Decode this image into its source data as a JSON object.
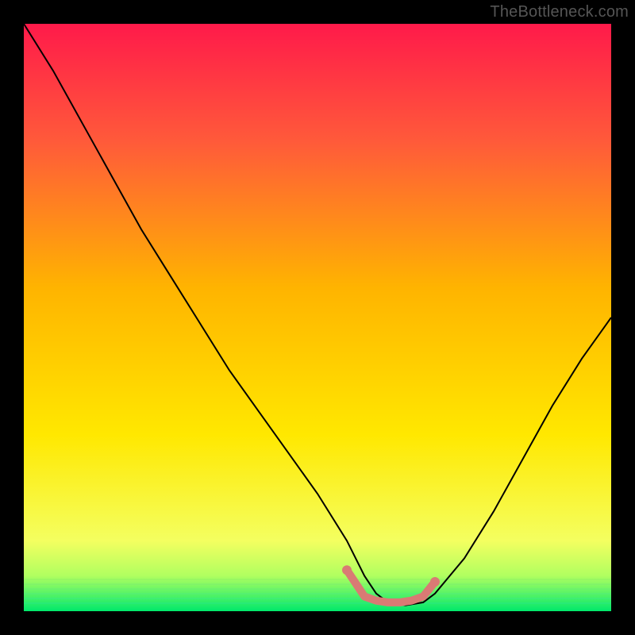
{
  "watermark": "TheBottleneck.com",
  "chart_data": {
    "type": "line",
    "title": "",
    "xlabel": "",
    "ylabel": "",
    "xlim": [
      0,
      100
    ],
    "ylim": [
      0,
      100
    ],
    "background_gradient": {
      "top": "#ff1a4a",
      "mid": "#ffe800",
      "bottom": "#00e86b"
    },
    "series": [
      {
        "name": "bottleneck-curve",
        "color": "#000000",
        "x": [
          0,
          5,
          10,
          15,
          20,
          25,
          30,
          35,
          40,
          45,
          50,
          55,
          58,
          60,
          62,
          65,
          68,
          70,
          75,
          80,
          85,
          90,
          95,
          100
        ],
        "y": [
          100,
          92,
          83,
          74,
          65,
          57,
          49,
          41,
          34,
          27,
          20,
          12,
          6,
          3,
          1.5,
          1,
          1.5,
          3,
          9,
          17,
          26,
          35,
          43,
          50
        ]
      },
      {
        "name": "highlight-segment",
        "color": "#d97a74",
        "x": [
          55,
          58,
          60,
          62,
          64,
          66,
          68,
          70
        ],
        "y": [
          7,
          2.5,
          1.8,
          1.5,
          1.5,
          1.8,
          2.5,
          5
        ]
      }
    ]
  }
}
